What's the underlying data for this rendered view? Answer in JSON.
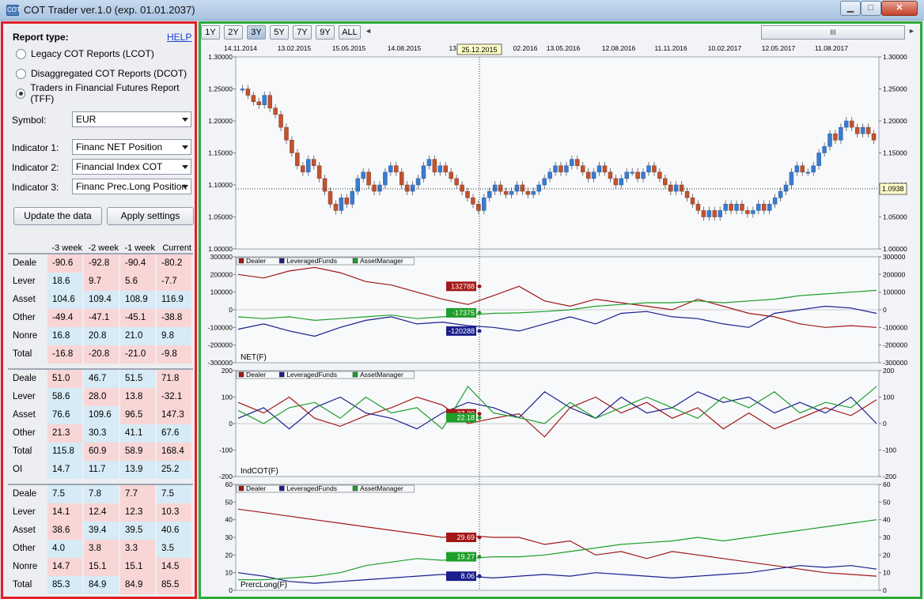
{
  "window": {
    "title": "COT Trader ver.1.0 (exp. 01.01.2037)",
    "min_glyph": "▁",
    "max_glyph": "□",
    "close_glyph": "✕"
  },
  "panel": {
    "report_label": "Report type:",
    "help": "HELP",
    "radios": [
      {
        "label": "Legacy COT Reports (LCOT)",
        "checked": false
      },
      {
        "label": "Disaggregated COT Reports (DCOT)",
        "checked": false
      },
      {
        "label": "Traders in Financial Futures Report (TFF)",
        "checked": true
      }
    ],
    "symbol_label": "Symbol:",
    "symbol": "EUR",
    "ind1_label": "Indicator 1:",
    "ind1": "Financ NET Position",
    "ind2_label": "Indicator 2:",
    "ind2": "Financial Index COT",
    "ind3_label": "Indicator 3:",
    "ind3": "Financ Prec.Long Position",
    "update_btn": "Update the data",
    "apply_btn": "Apply settings",
    "columns": [
      "-3 week",
      "-2 week",
      "-1 week",
      "Current"
    ],
    "groups": [
      [
        {
          "label": "Deale",
          "vals": [
            "-90.6",
            "-92.8",
            "-90.4",
            "-80.2"
          ]
        },
        {
          "label": "Lever",
          "vals": [
            "18.6",
            "9.7",
            "5.6",
            "-7.7"
          ]
        },
        {
          "label": "Asset",
          "vals": [
            "104.6",
            "109.4",
            "108.9",
            "116.9"
          ]
        },
        {
          "label": "Other",
          "vals": [
            "-49.4",
            "-47.1",
            "-45.1",
            "-38.8"
          ]
        },
        {
          "label": "Nonre",
          "vals": [
            "16.8",
            "20.8",
            "21.0",
            "9.8"
          ]
        },
        {
          "label": "Total",
          "vals": [
            "-16.8",
            "-20.8",
            "-21.0",
            "-9.8"
          ]
        }
      ],
      [
        {
          "label": "Deale",
          "vals": [
            "51.0",
            "46.7",
            "51.5",
            "71.8"
          ]
        },
        {
          "label": "Lever",
          "vals": [
            "58.6",
            "28.0",
            "13.8",
            "-32.1"
          ]
        },
        {
          "label": "Asset",
          "vals": [
            "76.6",
            "109.6",
            "96.5",
            "147.3"
          ]
        },
        {
          "label": "Other",
          "vals": [
            "21.3",
            "30.3",
            "41.1",
            "67.6"
          ]
        },
        {
          "label": "Total",
          "vals": [
            "115.8",
            "60.9",
            "58.9",
            "168.4"
          ]
        },
        {
          "label": "OI",
          "vals": [
            "14.7",
            "11.7",
            "13.9",
            "25.2"
          ]
        }
      ],
      [
        {
          "label": "Deale",
          "vals": [
            "7.5",
            "7.8",
            "7.7",
            "7.5"
          ]
        },
        {
          "label": "Lever",
          "vals": [
            "14.1",
            "12.4",
            "12.3",
            "10.3"
          ]
        },
        {
          "label": "Asset",
          "vals": [
            "38.6",
            "39.4",
            "39.5",
            "40.6"
          ]
        },
        {
          "label": "Other",
          "vals": [
            "4.0",
            "3.8",
            "3.3",
            "3.5"
          ]
        },
        {
          "label": "Nonre",
          "vals": [
            "14.7",
            "15.1",
            "15.1",
            "14.5"
          ]
        },
        {
          "label": "Total",
          "vals": [
            "85.3",
            "84.9",
            "84.9",
            "85.5"
          ]
        }
      ]
    ],
    "cell_colors": [
      [
        "neg",
        "neg",
        "neg",
        "neg",
        "pos",
        "neg",
        "neg",
        "neg",
        "pos",
        "pos",
        "pos",
        "pos",
        "neg",
        "neg",
        "neg",
        "neg",
        "pos",
        "pos",
        "pos",
        "pos",
        "neg",
        "neg",
        "neg",
        "neg"
      ],
      [
        "neg",
        "pos",
        "pos",
        "neg",
        "pos",
        "neg",
        "neg",
        "neg",
        "pos",
        "pos",
        "neg",
        "neg",
        "neg",
        "pos",
        "pos",
        "pos",
        "pos",
        "neg",
        "neg",
        "neg",
        "pos",
        "pos",
        "pos",
        "pos"
      ],
      [
        "pos",
        "pos",
        "neg",
        "pos",
        "neg",
        "neg",
        "neg",
        "neg",
        "neg",
        "pos",
        "pos",
        "pos",
        "pos",
        "neg",
        "neg",
        "pos",
        "neg",
        "neg",
        "neg",
        "neg",
        "pos",
        "pos",
        "neg",
        "neg"
      ]
    ]
  },
  "toolbar": {
    "ranges": [
      "1Y",
      "2Y",
      "3Y",
      "5Y",
      "7Y",
      "9Y",
      "ALL"
    ],
    "active": "3Y",
    "scroll_left": "◄",
    "scroll_right": "►",
    "scroll_thumb": "III"
  },
  "chart_data": {
    "crosshair_date": "25.12.2015",
    "dates": [
      "14.11.2014",
      "13.02.2015",
      "15.05.2015",
      "14.08.2015",
      "13.11.",
      "25.12.2015",
      "02.2016",
      "13.05.2016",
      "12.08.2016",
      "11.11.2016",
      "10.02.2017",
      "12.05.2017",
      "11.08.2017"
    ],
    "price": {
      "type": "candlestick",
      "ylim": [
        1.0,
        1.3
      ],
      "ticks": [
        "1.30000",
        "1.25000",
        "1.20000",
        "1.15000",
        "1.10000",
        "1.05000",
        "1.00000"
      ],
      "current_label": "1.0938",
      "current": 1.0938,
      "closes": [
        1.25,
        1.24,
        1.23,
        1.225,
        1.24,
        1.22,
        1.21,
        1.19,
        1.17,
        1.15,
        1.13,
        1.12,
        1.14,
        1.13,
        1.11,
        1.09,
        1.07,
        1.06,
        1.08,
        1.07,
        1.09,
        1.11,
        1.12,
        1.1,
        1.09,
        1.1,
        1.12,
        1.13,
        1.12,
        1.1,
        1.09,
        1.1,
        1.11,
        1.13,
        1.14,
        1.12,
        1.13,
        1.12,
        1.11,
        1.1,
        1.09,
        1.08,
        1.07,
        1.06,
        1.08,
        1.09,
        1.1,
        1.09,
        1.085,
        1.09,
        1.1,
        1.09,
        1.085,
        1.09,
        1.1,
        1.11,
        1.12,
        1.13,
        1.12,
        1.13,
        1.14,
        1.13,
        1.12,
        1.11,
        1.12,
        1.13,
        1.12,
        1.11,
        1.1,
        1.11,
        1.12,
        1.12,
        1.11,
        1.12,
        1.13,
        1.12,
        1.11,
        1.1,
        1.09,
        1.1,
        1.09,
        1.08,
        1.07,
        1.06,
        1.05,
        1.06,
        1.05,
        1.06,
        1.07,
        1.06,
        1.07,
        1.06,
        1.055,
        1.06,
        1.07,
        1.06,
        1.07,
        1.08,
        1.09,
        1.1,
        1.12,
        1.13,
        1.12,
        1.12,
        1.13,
        1.15,
        1.16,
        1.18,
        1.17,
        1.19,
        1.2,
        1.19,
        1.18,
        1.19,
        1.18,
        1.17
      ]
    },
    "net": {
      "name": "NET(F)",
      "ylim": [
        -300000,
        300000
      ],
      "ticks": [
        "300000",
        "200000",
        "100000",
        "0",
        "-100000",
        "-200000",
        "-300000"
      ],
      "markers": [
        {
          "label": "132788",
          "color": "#a31717"
        },
        {
          "label": "-17375",
          "color": "#1e9e2a"
        },
        {
          "label": "-120288",
          "color": "#1a1f8c"
        }
      ],
      "series": [
        {
          "name": "Dealer",
          "color": "#a31717",
          "values": [
            200000,
            180000,
            220000,
            240000,
            210000,
            160000,
            140000,
            100000,
            60000,
            30000,
            80000,
            132788,
            50000,
            20000,
            60000,
            40000,
            20000,
            0,
            60000,
            20000,
            -20000,
            -40000,
            -80000,
            -100000,
            -90000,
            -100000
          ]
        },
        {
          "name": "LeveragedFunds",
          "color": "#1a1f8c",
          "values": [
            -110000,
            -80000,
            -120000,
            -150000,
            -100000,
            -60000,
            -40000,
            -80000,
            -70000,
            -90000,
            -100000,
            -120288,
            -80000,
            -40000,
            -80000,
            -20000,
            -10000,
            -40000,
            -50000,
            -80000,
            -100000,
            -20000,
            0,
            20000,
            10000,
            -20000
          ]
        },
        {
          "name": "AssetManager",
          "color": "#1e9e2a",
          "values": [
            -40000,
            -50000,
            -40000,
            -60000,
            -50000,
            -40000,
            -30000,
            -50000,
            -40000,
            -30000,
            -20000,
            -17375,
            -10000,
            0,
            20000,
            30000,
            40000,
            40000,
            50000,
            40000,
            50000,
            60000,
            80000,
            90000,
            100000,
            110000
          ]
        }
      ]
    },
    "indcot": {
      "name": "IndCOT(F)",
      "ylim": [
        -200,
        200
      ],
      "ticks": [
        "200",
        "100",
        "0",
        "-100",
        "-200"
      ],
      "markers": [
        {
          "label": "37.30",
          "color": "#a31717"
        },
        {
          "label": "22.18",
          "color": "#1e9e2a"
        }
      ],
      "series": [
        {
          "name": "Dealer",
          "color": "#a31717",
          "values": [
            80,
            40,
            100,
            20,
            -10,
            30,
            60,
            100,
            70,
            0,
            20,
            37,
            -50,
            60,
            100,
            40,
            80,
            20,
            60,
            -20,
            40,
            -20,
            20,
            60,
            30,
            90
          ]
        },
        {
          "name": "LeveragedFunds",
          "color": "#1a1f8c",
          "values": [
            20,
            60,
            -20,
            60,
            100,
            40,
            20,
            -20,
            40,
            80,
            60,
            22,
            120,
            60,
            20,
            100,
            40,
            60,
            120,
            80,
            100,
            40,
            80,
            40,
            100,
            0
          ]
        },
        {
          "name": "AssetManager",
          "color": "#1e9e2a",
          "values": [
            50,
            0,
            60,
            80,
            20,
            100,
            40,
            60,
            -20,
            140,
            40,
            22,
            0,
            80,
            20,
            60,
            100,
            60,
            20,
            100,
            60,
            120,
            40,
            80,
            60,
            140
          ]
        }
      ]
    },
    "preclong": {
      "name": "PrercLong(F)",
      "ylim": [
        0,
        60
      ],
      "ticks": [
        "60",
        "50",
        "40",
        "30",
        "20",
        "10",
        "0"
      ],
      "markers": [
        {
          "label": "29.69",
          "color": "#a31717"
        },
        {
          "label": "19.27",
          "color": "#1e9e2a"
        },
        {
          "label": "8.06",
          "color": "#1a1f8c"
        }
      ],
      "series": [
        {
          "name": "Dealer",
          "color": "#a31717",
          "values": [
            46,
            44,
            42,
            40,
            38,
            36,
            34,
            32,
            30,
            31,
            30,
            30,
            26,
            28,
            20,
            22,
            18,
            22,
            20,
            18,
            16,
            14,
            12,
            10,
            9,
            8
          ]
        },
        {
          "name": "LeveragedFunds",
          "color": "#1a1f8c",
          "values": [
            10,
            8,
            5,
            4,
            5,
            6,
            7,
            8,
            9,
            8,
            7,
            8,
            9,
            8,
            10,
            9,
            8,
            7,
            8,
            9,
            10,
            12,
            14,
            13,
            14,
            12
          ]
        },
        {
          "name": "AssetManager",
          "color": "#1e9e2a",
          "values": [
            6,
            6,
            7,
            8,
            10,
            14,
            16,
            18,
            17,
            18,
            19,
            19,
            20,
            22,
            24,
            26,
            27,
            28,
            30,
            28,
            30,
            32,
            34,
            36,
            38,
            40
          ]
        }
      ]
    }
  }
}
